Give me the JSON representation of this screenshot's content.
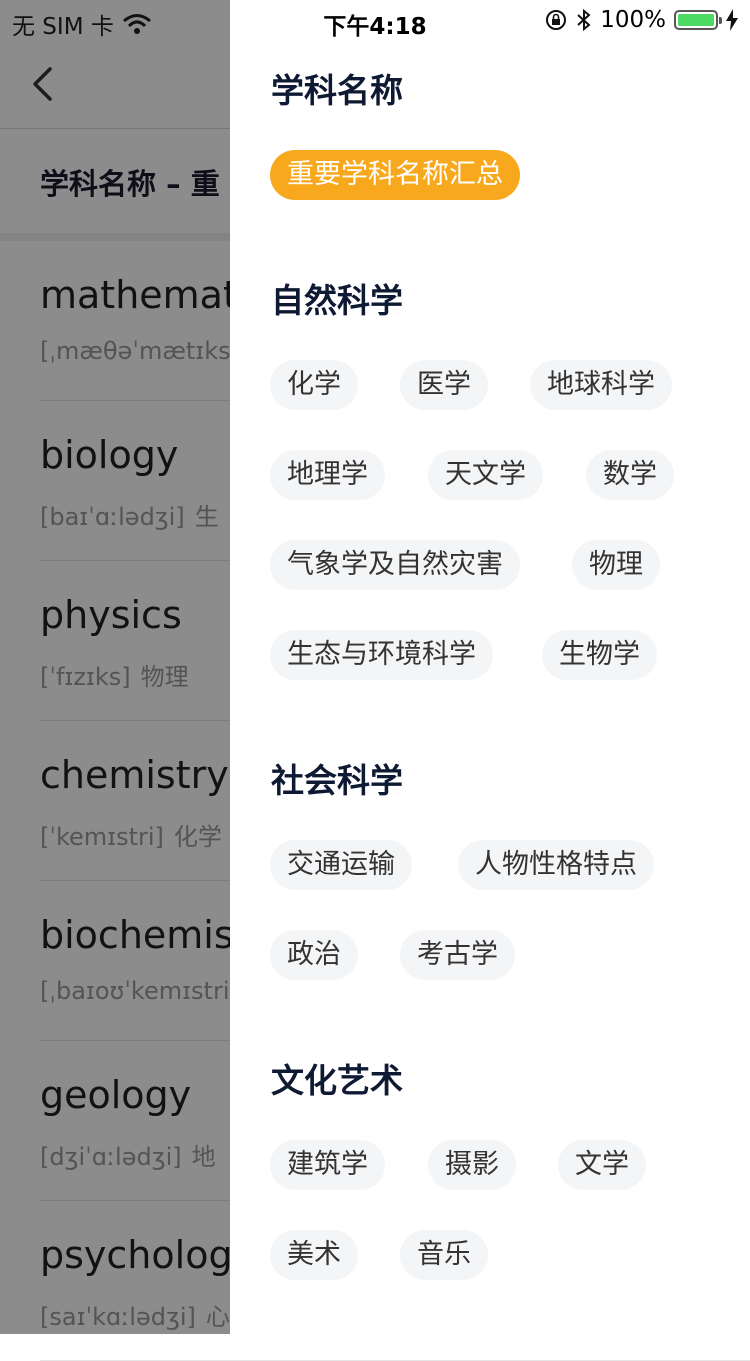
{
  "status_bar": {
    "carrier": "无 SIM 卡",
    "time": "下午4:18",
    "battery": "100%",
    "battery_color": "#4cd964"
  },
  "background": {
    "sub_title": "学科名称 – 重",
    "words": [
      {
        "word": "mathemat",
        "phonetic": "[ˌmæθəˈmætɪks",
        "meaning": ""
      },
      {
        "word": "biology",
        "phonetic": "[baɪˈɑːlədʒi]",
        "meaning": "生"
      },
      {
        "word": "physics",
        "phonetic": "[ˈfɪzɪks]",
        "meaning": "物理"
      },
      {
        "word": "chemistry",
        "phonetic": "[ˈkemɪstri]",
        "meaning": "化学"
      },
      {
        "word": "biochemis",
        "phonetic": "[ˌbaɪoʊˈkemɪstri",
        "meaning": ""
      },
      {
        "word": "geology",
        "phonetic": "[dʒiˈɑːlədʒi]",
        "meaning": "地"
      },
      {
        "word": "psycholog",
        "phonetic": "[saɪˈkɑːlədʒi]",
        "meaning": "心"
      }
    ]
  },
  "drawer": {
    "header": "学科名称",
    "highlight_chip": "重要学科名称汇总",
    "accent_color": "#f8a81d",
    "sections": [
      {
        "title": "自然科学",
        "chips": [
          "化学",
          "医学",
          "地球科学",
          "地理学",
          "天文学",
          "数学",
          "气象学及自然灾害",
          "物理",
          "生态与环境科学",
          "生物学"
        ]
      },
      {
        "title": "社会科学",
        "chips": [
          "交通运输",
          "人物性格特点",
          "政治",
          "考古学"
        ]
      },
      {
        "title": "文化艺术",
        "chips": [
          "建筑学",
          "摄影",
          "文学",
          "美术",
          "音乐"
        ]
      }
    ]
  }
}
